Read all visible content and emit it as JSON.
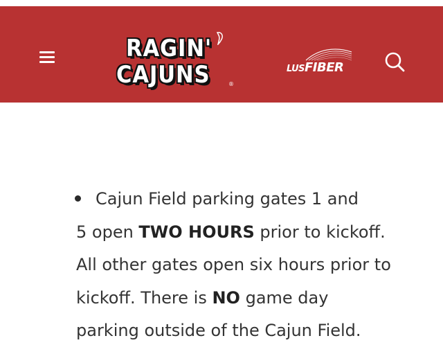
{
  "header": {
    "logo_line1": "RAGIN'",
    "logo_line2": "CAJUNS",
    "logo_registered": "®",
    "sponsor_lus": "LUS",
    "sponsor_fiber": "FIBER",
    "menu_icon": "hamburger-menu-icon",
    "search_icon": "search-icon",
    "background_color": "#b83232"
  },
  "content": {
    "line1": "Cajun Field parking gates 1 and",
    "line2_pre": "5 open ",
    "line2_bold": "TWO HOURS",
    "line2_post": " prior to kickoff.",
    "line3": "All other gates open six hours prior to",
    "line4_pre": "kickoff. There is ",
    "line4_bold": "NO",
    "line4_post": " game day",
    "line5": "parking outside of the Cajun Field."
  }
}
